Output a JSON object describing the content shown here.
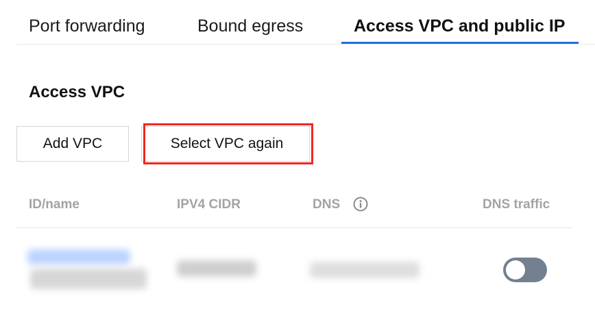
{
  "tabs": [
    {
      "label": "Port forwarding"
    },
    {
      "label": "Bound egress"
    },
    {
      "label": "Access VPC and public IP",
      "active": true
    }
  ],
  "section": {
    "title": "Access VPC"
  },
  "buttons": {
    "add_vpc": "Add VPC",
    "select_vpc_again": "Select VPC again"
  },
  "table": {
    "columns": [
      "ID/name",
      "IPV4 CIDR",
      "DNS",
      "DNS traffic"
    ],
    "rows": [
      {
        "dns_traffic_enabled": false
      }
    ]
  },
  "icons": {
    "dns_info": "info-icon"
  },
  "colors": {
    "accent": "#1f6fd8",
    "highlight": "#f0281f",
    "toggle_off": "#73808f"
  }
}
